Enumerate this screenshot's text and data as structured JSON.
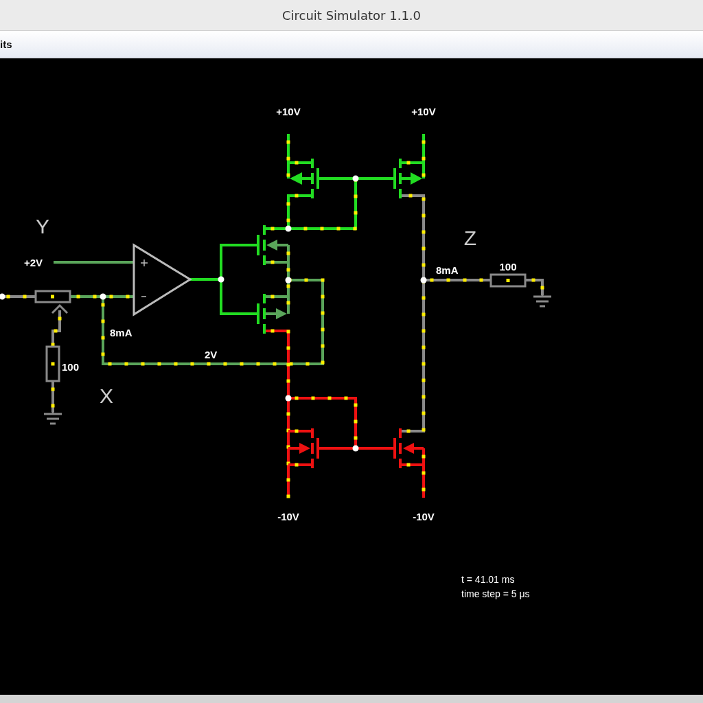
{
  "window": {
    "title": "Circuit Simulator 1.1.0"
  },
  "menu_bar": {
    "items": [
      {
        "label": "its"
      }
    ]
  },
  "circuit": {
    "probe_labels": [
      "Y",
      "X",
      "Z"
    ],
    "input_voltage": "+2V",
    "supplies_top": [
      "+10V",
      "+10V"
    ],
    "supplies_bottom": [
      "-10V",
      "-10V"
    ],
    "currents": [
      "8mA",
      "8mA"
    ],
    "resistors": [
      "100",
      "100"
    ],
    "node_voltage": "2V"
  },
  "status": {
    "lines": [
      "t = 41.01 ms",
      "time step = 5 μs"
    ]
  }
}
